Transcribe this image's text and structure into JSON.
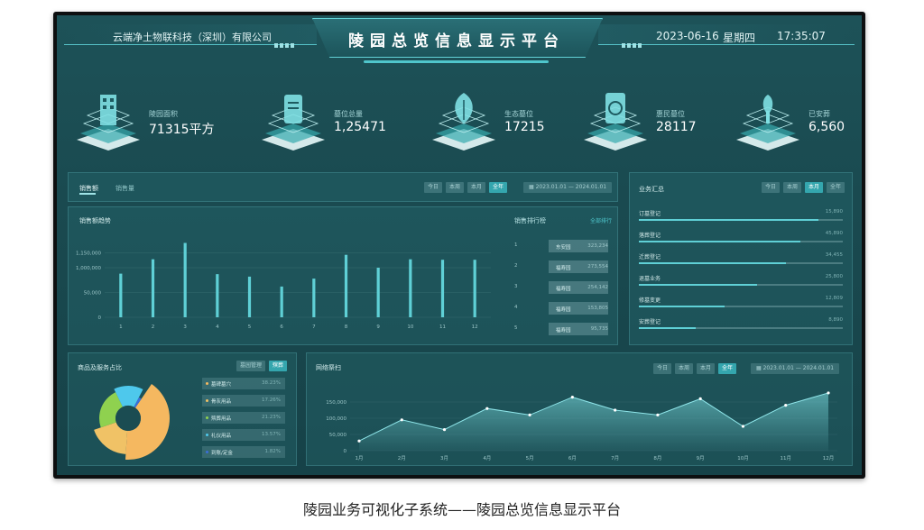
{
  "header": {
    "company": "云端净土物联科技（深圳）有限公司",
    "title": "陵园总览信息显示平台",
    "date": "2023-06-16",
    "weekday": "星期四",
    "time": "17:35:07"
  },
  "kpis": [
    {
      "label": "陵园面积",
      "value": "71315平方",
      "icon": "building-icon"
    },
    {
      "label": "墓位总量",
      "value": "1,25471",
      "icon": "document-icon"
    },
    {
      "label": "生态墓位",
      "value": "17215",
      "icon": "leaf-icon"
    },
    {
      "label": "惠民墓位",
      "value": "28117",
      "icon": "refresh-icon"
    },
    {
      "label": "已安葬",
      "value": "6,560",
      "icon": "plant-icon"
    }
  ],
  "sales": {
    "tabs": [
      "销售额",
      "销售量"
    ],
    "period_buttons": [
      "今日",
      "本周",
      "本月",
      "全年"
    ],
    "active_period": "全年",
    "date_range": "2023.01.01 — 2024.01.01",
    "chart_title": "销售额趋势",
    "rank_title": "销售排行榜",
    "rank_link": "全部排行",
    "ranks": [
      {
        "num": "1",
        "name": "东安园",
        "value": "323,234"
      },
      {
        "num": "2",
        "name": "福寿园",
        "value": "273,554"
      },
      {
        "num": "3",
        "name": "福寿园",
        "value": "254,142"
      },
      {
        "num": "4",
        "name": "福寿园",
        "value": "153,805"
      },
      {
        "num": "5",
        "name": "福寿园",
        "value": "95,735"
      }
    ]
  },
  "business": {
    "title": "业务汇总",
    "period_buttons": [
      "今日",
      "本周",
      "本月",
      "全年"
    ],
    "active_period": "本月",
    "items": [
      {
        "name": "订墓登记",
        "value": "15,890",
        "ratio": 0.88
      },
      {
        "name": "落葬登记",
        "value": "45,890",
        "ratio": 0.79
      },
      {
        "name": "迁葬登记",
        "value": "34,455",
        "ratio": 0.72
      },
      {
        "name": "退墓业务",
        "value": "25,800",
        "ratio": 0.58
      },
      {
        "name": "修墓变更",
        "value": "12,809",
        "ratio": 0.42
      },
      {
        "name": "安葬登记",
        "value": "8,890",
        "ratio": 0.28
      }
    ]
  },
  "products": {
    "title": "商品及服务占比",
    "buttons": [
      "墓园管理",
      "殡葬"
    ],
    "active_button": "殡葬",
    "legend": [
      {
        "name": "墓碑墓穴",
        "value": "38.23%",
        "color": "#f5b860"
      },
      {
        "name": "骨灰用品",
        "value": "17.26%",
        "color": "#f0c266"
      },
      {
        "name": "殡葬用品",
        "value": "21.23%",
        "color": "#8fd14f"
      },
      {
        "name": "礼仪用品",
        "value": "13.57%",
        "color": "#4ec8ec"
      },
      {
        "name": "到账/定金",
        "value": "1.82%",
        "color": "#3a6fd9"
      }
    ]
  },
  "network": {
    "title": "网络祭扫",
    "period_buttons": [
      "今日",
      "本周",
      "本月",
      "全年"
    ],
    "active_period": "全年",
    "date_range": "2023.01.01 — 2024.01.01"
  },
  "chart_data": [
    {
      "type": "bar",
      "title": "销售额趋势",
      "categories": [
        "1",
        "2",
        "3",
        "4",
        "5",
        "6",
        "7",
        "8",
        "9",
        "10",
        "11",
        "12"
      ],
      "values": [
        880000,
        1170000,
        1500000,
        870000,
        820000,
        620000,
        780000,
        1260000,
        1000000,
        1170000,
        1160000,
        1160000
      ],
      "ytick_labels": [
        "0",
        "50,000",
        "1,000,000",
        "1,150,000"
      ],
      "ylim": [
        0,
        1600000
      ]
    },
    {
      "type": "pie",
      "title": "商品及服务占比",
      "labels": [
        "墓碑墓穴",
        "骨灰用品",
        "殡葬用品",
        "礼仪用品",
        "到账/定金"
      ],
      "values": [
        38.23,
        17.26,
        21.23,
        13.57,
        1.82
      ],
      "colors": [
        "#f5b860",
        "#f0c266",
        "#8fd14f",
        "#4ec8ec",
        "#3a6fd9"
      ]
    },
    {
      "type": "area",
      "title": "网络祭扫",
      "categories": [
        "1月",
        "2月",
        "3月",
        "4月",
        "5月",
        "6月",
        "7月",
        "8月",
        "9月",
        "10月",
        "11月",
        "12月"
      ],
      "values": [
        30000,
        95000,
        65000,
        130000,
        110000,
        165000,
        125000,
        110000,
        160000,
        75000,
        140000,
        178000
      ],
      "ytick_labels": [
        "0",
        "50,000",
        "100,000",
        "150,000"
      ],
      "ylim": [
        0,
        200000
      ]
    }
  ],
  "caption": "陵园业务可视化子系统——陵园总览信息显示平台"
}
